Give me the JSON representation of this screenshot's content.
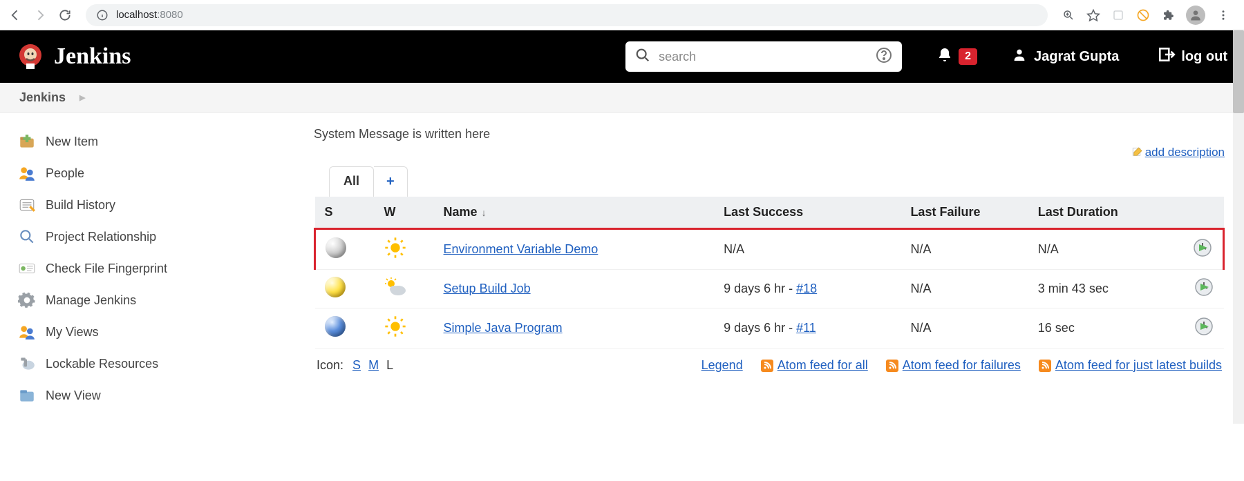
{
  "browser": {
    "url_host": "localhost",
    "url_port": ":8080"
  },
  "header": {
    "brand": "Jenkins",
    "search_placeholder": "search",
    "notif_count": "2",
    "username": "Jagrat Gupta",
    "logout_label": "log out"
  },
  "breadcrumb": {
    "root": "Jenkins"
  },
  "sidebar": {
    "items": [
      {
        "label": "New Item"
      },
      {
        "label": "People"
      },
      {
        "label": "Build History"
      },
      {
        "label": "Project Relationship"
      },
      {
        "label": "Check File Fingerprint"
      },
      {
        "label": "Manage Jenkins"
      },
      {
        "label": "My Views"
      },
      {
        "label": "Lockable Resources"
      },
      {
        "label": "New View"
      }
    ]
  },
  "content": {
    "system_message": "System Message is written here",
    "add_description": "add description",
    "tabs": {
      "all": "All",
      "add": "+"
    },
    "columns": {
      "s": "S",
      "w": "W",
      "name": "Name",
      "sort_indicator": "↓",
      "last_success": "Last Success",
      "last_failure": "Last Failure",
      "last_duration": "Last Duration"
    },
    "jobs": [
      {
        "status": "grey",
        "weather": "sun",
        "name": "Environment Variable Demo",
        "last_success_text": "N/A",
        "last_success_build": "",
        "last_failure": "N/A",
        "last_duration": "N/A",
        "highlight": true
      },
      {
        "status": "yellow",
        "weather": "cloud-sun",
        "name": "Setup Build Job",
        "last_success_text": "9 days 6 hr - ",
        "last_success_build": "#18",
        "last_failure": "N/A",
        "last_duration": "3 min 43 sec",
        "highlight": false
      },
      {
        "status": "blue",
        "weather": "sun",
        "name": "Simple Java Program",
        "last_success_text": "9 days 6 hr - ",
        "last_success_build": "#11",
        "last_failure": "N/A",
        "last_duration": "16 sec",
        "highlight": false
      }
    ],
    "icon_label": "Icon:",
    "icon_sizes": {
      "s": "S",
      "m": "M",
      "l": "L"
    },
    "footer": {
      "legend": "Legend",
      "feed_all": "Atom feed for all",
      "feed_failures": "Atom feed for failures",
      "feed_latest": "Atom feed for just latest builds"
    }
  }
}
